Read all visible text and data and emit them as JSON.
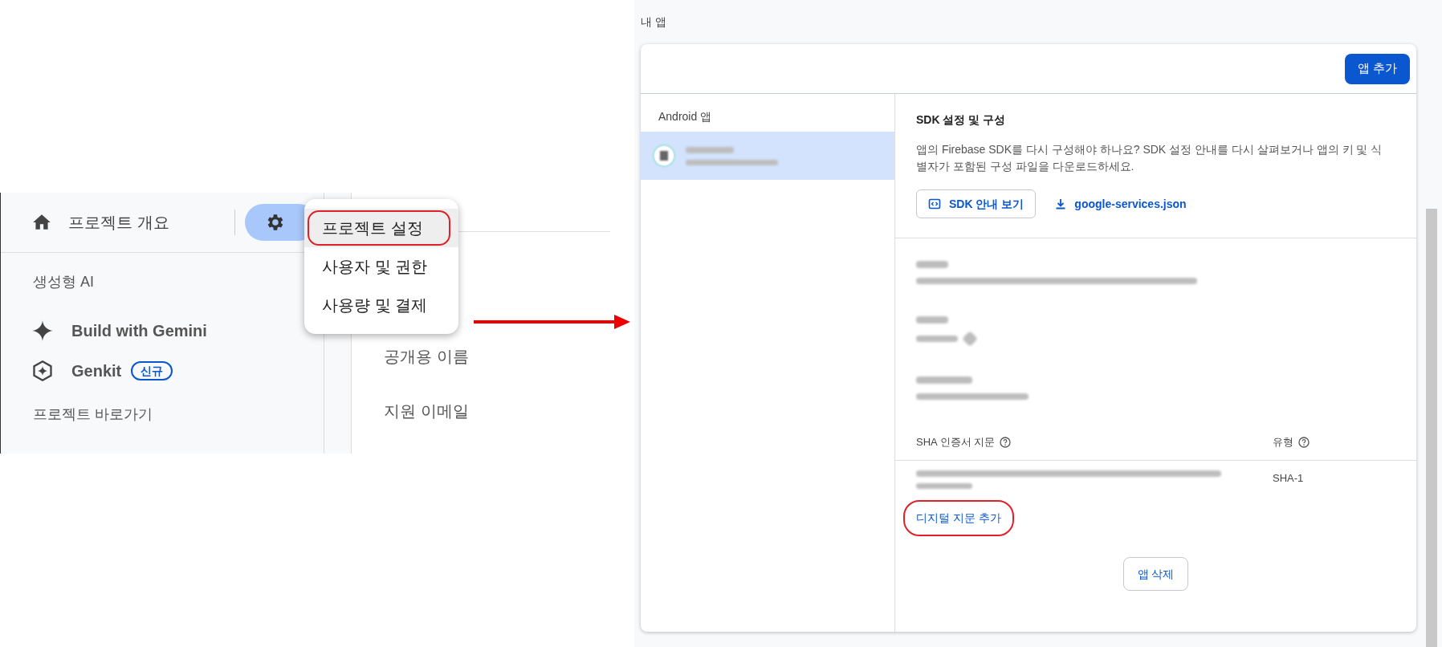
{
  "left_screen": {
    "sidebar": {
      "home": {
        "label": "프로젝트 개요"
      },
      "sections": [
        {
          "title": "생성형 AI",
          "items": [
            {
              "label": "Build with Gemini"
            },
            {
              "label": "Genkit",
              "badge": "신규"
            }
          ]
        },
        {
          "title": "프로젝트 바로가기"
        }
      ]
    },
    "settings_menu": [
      {
        "label": "프로젝트 설정",
        "selected": true,
        "circled": true
      },
      {
        "label": "사용자 및 권한",
        "selected": false,
        "circled": false
      },
      {
        "label": "사용량 및 결제",
        "selected": false,
        "circled": false
      }
    ],
    "content_labels": [
      "공개용 이름",
      "지원 이메일"
    ]
  },
  "right_screen": {
    "page_title": "내 앱",
    "add_app_button": "앱 추가",
    "app_list": {
      "title": "Android 앱"
    },
    "sdk": {
      "title": "SDK 설정 및 구성",
      "description": "앱의 Firebase SDK를 다시 구성해야 하나요? SDK 설정 안내를 다시 살펴보거나 앱의 키 및 식별자가 포함된 구성 파일을 다운로드하세요.",
      "guide_button": "SDK 안내 보기",
      "download_link": "google-services.json"
    },
    "fingerprints": {
      "columns": [
        "SHA 인증서 지문",
        "유형"
      ],
      "rows": [
        {
          "type": "SHA-1"
        }
      ],
      "add_link": {
        "label": "디지털 지문 추가",
        "circled": true
      }
    },
    "delete_button": "앱 삭제"
  }
}
